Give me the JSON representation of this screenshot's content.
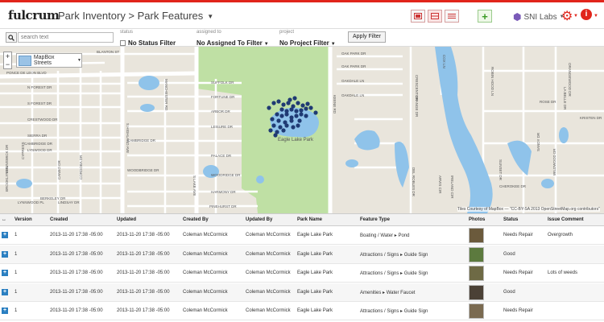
{
  "app": {
    "logo": "fulcrum"
  },
  "header": {
    "breadcrumb": "Park Inventory > Park Features",
    "org": "SNI Labs",
    "info_label": "i",
    "add_label": "+"
  },
  "filters": {
    "search_placeholder": "search text",
    "status_label": "status",
    "status_value": "No Status Filter",
    "assigned_label": "assigned to",
    "assigned_value": "No Assigned To Filter",
    "project_label": "project",
    "project_value": "No Project Filter",
    "apply_label": "Apply Filter"
  },
  "map": {
    "layer": "MapBox Streets",
    "zoom_in": "+",
    "zoom_out": "−",
    "park_label": "Eagle Lake Park",
    "attribution": "Tiles Courtesy of MapBox — \"CC-BY-SA 2013 OpenStreetMap.org contributors\"",
    "streets": [
      "BLANTON ST",
      "PONCE DE LEON BLVD",
      "SUFFOLK DR",
      "FORTUNE DR",
      "ARBOR DR",
      "LEISURE DR",
      "CAMBRIDGE DR",
      "CAMBRIDGE DR",
      "PALACE DR",
      "WOODRIDGE DR",
      "HARMONY DR",
      "PINEHURST DR",
      "OAK PARK DR",
      "OAK PARK DR",
      "OAKDALE LN",
      "OAKDALE LN",
      "N FOREST DR",
      "S FOREST DR",
      "CRESTWOOD DR",
      "SIERRA DR",
      "BRUNSWICK DR",
      "LYNWOOD DR",
      "CANEO DR",
      "CORDOBA DR",
      "BERKELEY DR",
      "S HIGHLAND AVE",
      "S LAKE AVE",
      "KEENE RD",
      "ROBIN HOOD LN",
      "COX LN",
      "CRESCENT DR",
      "ORANGE DR",
      "ORANGEWOOD DR",
      "KRISTEN DR",
      "SANDY DR",
      "SUNSET DR",
      "LA BELLE DR",
      "DEL ROBLES DR",
      "ARVIS CIR",
      "IRELAND CIR",
      "ROSE DR",
      "WILDWOOD DR",
      "CHEROKEE DR",
      "MANCHESTER RD",
      "BROOKLYN LN",
      "WOODBRIDGE DR",
      "LYNNWOOD PL",
      "LINDSAY DR",
      "CYPRESS"
    ]
  },
  "table": {
    "columns": [
      "↔",
      "Version",
      "Created",
      "Updated",
      "Created By",
      "Updated By",
      "Park Name",
      "Feature Type",
      "Photos",
      "Status",
      "Issue Comment"
    ],
    "rows": [
      {
        "version": "1",
        "created": "2013-11-20 17:38 -05:00",
        "updated": "2013-11-20 17:38 -05:00",
        "created_by": "Coleman McCormick",
        "updated_by": "Coleman McCormick",
        "park": "Eagle Lake Park",
        "feature": "Boating / Water ▸ Pond",
        "status": "Needs Repair",
        "comment": "Overgrowth",
        "photo_color": "#6b5a3c"
      },
      {
        "version": "1",
        "created": "2013-11-20 17:38 -05:00",
        "updated": "2013-11-20 17:38 -05:00",
        "created_by": "Coleman McCormick",
        "updated_by": "Coleman McCormick",
        "park": "Eagle Lake Park",
        "feature": "Attractions / Signs ▸ Guide Sign",
        "status": "Good",
        "comment": "",
        "photo_color": "#5c7a3e"
      },
      {
        "version": "1",
        "created": "2013-11-20 17:38 -05:00",
        "updated": "2013-11-20 17:38 -05:00",
        "created_by": "Coleman McCormick",
        "updated_by": "Coleman McCormick",
        "park": "Eagle Lake Park",
        "feature": "Attractions / Signs ▸ Guide Sign",
        "status": "Needs Repair",
        "comment": "Lots of weeds",
        "photo_color": "#6e6a45"
      },
      {
        "version": "1",
        "created": "2013-11-20 17:38 -05:00",
        "updated": "2013-11-20 17:38 -05:00",
        "created_by": "Coleman McCormick",
        "updated_by": "Coleman McCormick",
        "park": "Eagle Lake Park",
        "feature": "Amenities ▸ Water Faucet",
        "status": "Good",
        "comment": "",
        "photo_color": "#4b4136"
      },
      {
        "version": "1",
        "created": "2013-11-20 17:38 -05:00",
        "updated": "2013-11-20 17:38 -05:00",
        "created_by": "Coleman McCormick",
        "updated_by": "Coleman McCormick",
        "park": "Eagle Lake Park",
        "feature": "Attractions / Signs ▸ Guide Sign",
        "status": "Needs Repair",
        "comment": "",
        "photo_color": "#7a6a50"
      }
    ]
  },
  "colors": {
    "accent": "#e1251b",
    "park_green": "#bfe0a4",
    "water": "#8fc3ea",
    "point": "#1f3a73"
  }
}
